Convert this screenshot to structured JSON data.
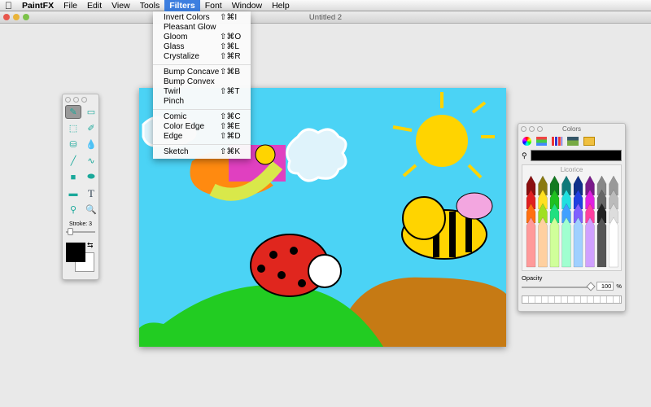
{
  "menubar": {
    "apple": "",
    "app": "PaintFX",
    "items": [
      "File",
      "Edit",
      "View",
      "Tools",
      "Filters",
      "Font",
      "Window",
      "Help"
    ]
  },
  "window": {
    "title": "Untitled 2"
  },
  "filters_menu": {
    "groups": [
      [
        {
          "label": "Invert Colors",
          "shortcut": "⇧⌘I"
        },
        {
          "label": "Pleasant Glow",
          "shortcut": ""
        },
        {
          "label": "Gloom",
          "shortcut": "⇧⌘O"
        },
        {
          "label": "Glass",
          "shortcut": "⇧⌘L"
        },
        {
          "label": "Crystalize",
          "shortcut": "⇧⌘R"
        }
      ],
      [
        {
          "label": "Bump Concave",
          "shortcut": "⇧⌘B"
        },
        {
          "label": "Bump Convex",
          "shortcut": ""
        },
        {
          "label": "Twirl",
          "shortcut": "⇧⌘T"
        },
        {
          "label": "Pinch",
          "shortcut": ""
        }
      ],
      [
        {
          "label": "Comic",
          "shortcut": "⇧⌘C"
        },
        {
          "label": "Color Edge",
          "shortcut": "⇧⌘E"
        },
        {
          "label": "Edge",
          "shortcut": "⇧⌘D"
        }
      ],
      [
        {
          "label": "Sketch",
          "shortcut": "⇧⌘K"
        }
      ]
    ]
  },
  "tools": {
    "items": [
      "brush",
      "eraser",
      "select",
      "fill-marker",
      "bucket",
      "drop",
      "line",
      "curve",
      "rect",
      "oval",
      "rounded-rect",
      "text",
      "eyedropper",
      "zoom"
    ],
    "text_glyph": "T",
    "stroke_label": "Stroke: 3",
    "stroke": 3,
    "fg": "#000000",
    "bg": "#ffffff"
  },
  "colors_panel": {
    "title": "Colors",
    "color_name": "Licorice",
    "opacity_label": "Opacity",
    "opacity": "100",
    "percent": "%"
  }
}
